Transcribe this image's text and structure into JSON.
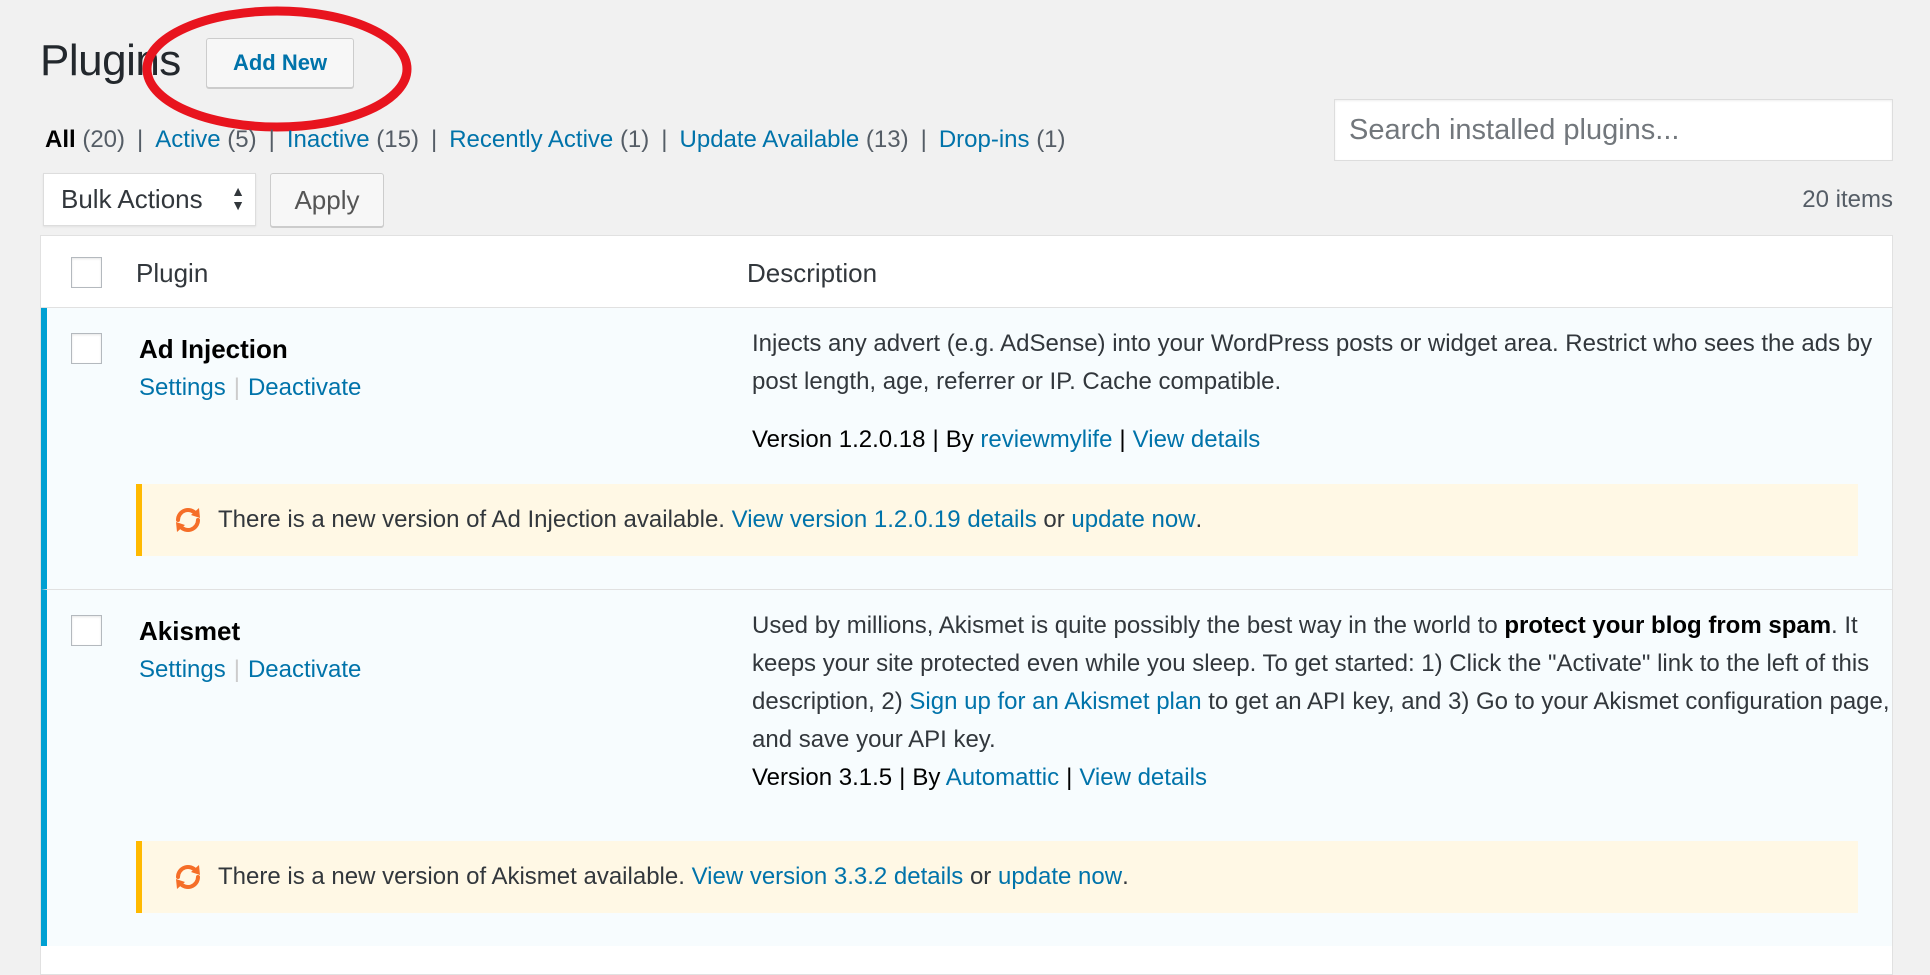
{
  "header": {
    "title": "Plugins",
    "add_new_label": "Add New"
  },
  "filters": {
    "all": {
      "label": "All",
      "count": "(20)"
    },
    "active": {
      "label": "Active",
      "count": "(5)"
    },
    "inactive": {
      "label": "Inactive",
      "count": "(15)"
    },
    "recently_active": {
      "label": "Recently Active",
      "count": "(1)"
    },
    "update_available": {
      "label": "Update Available",
      "count": "(13)"
    },
    "drop_ins": {
      "label": "Drop-ins",
      "count": "(1)"
    },
    "separator": "|"
  },
  "search": {
    "placeholder": "Search installed plugins..."
  },
  "bulk": {
    "select_value": "Bulk Actions",
    "apply_label": "Apply",
    "items_count": "20 items"
  },
  "table": {
    "columns": [
      "Plugin",
      "Description"
    ]
  },
  "plugins": [
    {
      "name": "Ad Injection",
      "actions": [
        "Settings",
        "Deactivate"
      ],
      "description": "Injects any advert (e.g. AdSense) into your WordPress posts or widget area. Restrict who sees the ads by post length, age, referrer or IP. Cache compatible.",
      "version": "Version 1.2.0.18",
      "by": "By",
      "author": "reviewmylife",
      "view_details": "View details",
      "notice": {
        "text": "There is a new version of Ad Injection available.",
        "link1": "View version 1.2.0.19 details",
        "or": "or",
        "link2": "update now",
        "end": "."
      }
    },
    {
      "name": "Akismet",
      "actions": [
        "Settings",
        "Deactivate"
      ],
      "description_parts": {
        "p1": "Used by millions, Akismet is quite possibly the best way in the world to ",
        "bold": "protect your blog from spam",
        "p2": ". It keeps your site protected even while you sleep. To get started: 1) Click the \"Activate\" link to the left of this description, 2) ",
        "link": "Sign up for an Akismet plan",
        "p3": " to get an API key, and 3) Go to your Akismet configuration page, and save your API key."
      },
      "version": "Version 3.1.5",
      "by": "By",
      "author": "Automattic",
      "view_details": "View details",
      "notice": {
        "text": "There is a new version of Akismet available.",
        "link1": "View version 3.3.2 details",
        "or": "or",
        "link2": "update now",
        "end": "."
      }
    }
  ],
  "colors": {
    "link": "#0073aa",
    "active_row_border": "#00a0d2",
    "notice_border": "#ffb900",
    "notice_bg": "#fff8e5",
    "highlight": "#e8141e",
    "update_icon": "#f56e28"
  },
  "icons": {
    "update": "update-icon",
    "select_arrows": "select-arrows-icon"
  }
}
